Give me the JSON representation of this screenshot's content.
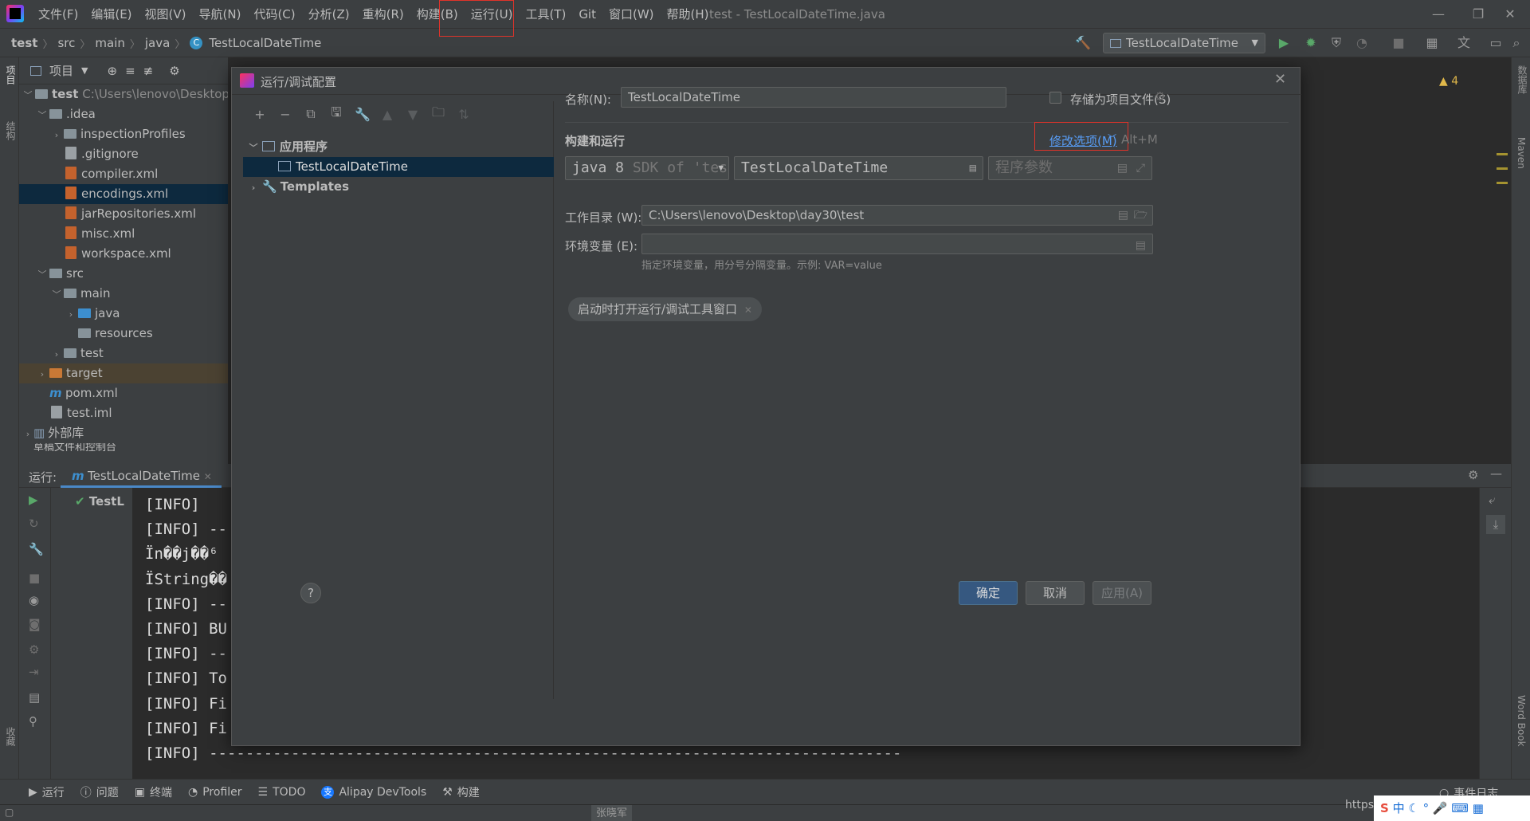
{
  "menu": {
    "items": [
      "文件(F)",
      "编辑(E)",
      "视图(V)",
      "导航(N)",
      "代码(C)",
      "分析(Z)",
      "重构(R)",
      "构建(B)",
      "运行(U)",
      "工具(T)",
      "Git",
      "窗口(W)",
      "帮助(H)"
    ],
    "highlighted": "运行(U)"
  },
  "window_title": "test - TestLocalDateTime.java",
  "breadcrumb": [
    "test",
    "src",
    "main",
    "java",
    "TestLocalDateTime"
  ],
  "run_config_selector": "TestLocalDateTime",
  "project_panel": {
    "title": "项目",
    "root": "test",
    "root_path": "C:\\Users\\lenovo\\Desktop\\",
    "items": [
      ".idea",
      "inspectionProfiles",
      ".gitignore",
      "compiler.xml",
      "encodings.xml",
      "jarRepositories.xml",
      "misc.xml",
      "workspace.xml",
      "src",
      "main",
      "java",
      "resources",
      "test",
      "target",
      "pom.xml",
      "test.iml",
      "外部库",
      "草稿文件和控制台"
    ]
  },
  "run_panel": {
    "label": "运行:",
    "tab": "TestLocalDateTime",
    "tree_item": "TestL",
    "console_lines": [
      "[INFO]",
      "[INFO] --",
      "Ïn��j��⁶",
      "ÏString��",
      "[INFO] --",
      "[INFO] BU",
      "[INFO] --",
      "[INFO] To",
      "[INFO] Fi",
      "[INFO] Fi",
      "[INFO] ----------------------------------------------------------------------------"
    ]
  },
  "bottom_bar": {
    "items": [
      "运行",
      "问题",
      "终端",
      "Profiler",
      "TODO",
      "Alipay DevTools",
      "构建"
    ],
    "event_log": "事件日志",
    "url_fragment": "https",
    "tooltip_name": "张晓军"
  },
  "right_stripe": [
    "数据库",
    "Maven",
    "Word Book"
  ],
  "left_stripe": [
    "项目",
    "结构",
    "收藏"
  ],
  "editor": {
    "warning_count": "4"
  },
  "dialog": {
    "title": "运行/调试配置",
    "tree": {
      "group": "应用程序",
      "selected": "TestLocalDateTime",
      "templates": "Templates"
    },
    "name_label": "名称(N):",
    "name_value": "TestLocalDateTime",
    "store_as_project_file": "存储为项目文件(S)",
    "section_build_run": "构建和运行",
    "modify_options": "修改选项(M)",
    "modify_shortcut": "Alt+M",
    "jre_value": "java 8",
    "jre_hint": "SDK of 'tes",
    "main_class": "TestLocalDateTime",
    "program_args_placeholder": "程序参数",
    "workdir_label": "工作目录 (W):",
    "workdir_value": "C:\\Users\\lenovo\\Desktop\\day30\\test",
    "env_label": "环境变量 (E):",
    "env_hint": "指定环境变量，用分号分隔变量。示例: VAR=value",
    "chip_open_tool_window": "启动时打开运行/调试工具窗口",
    "help": "?",
    "ok": "确定",
    "cancel": "取消",
    "apply": "应用(A)"
  },
  "colors": {
    "accent_blue": "#365880",
    "link_blue": "#589df6",
    "highlight_red": "#e0332a",
    "run_green": "#59a869"
  }
}
